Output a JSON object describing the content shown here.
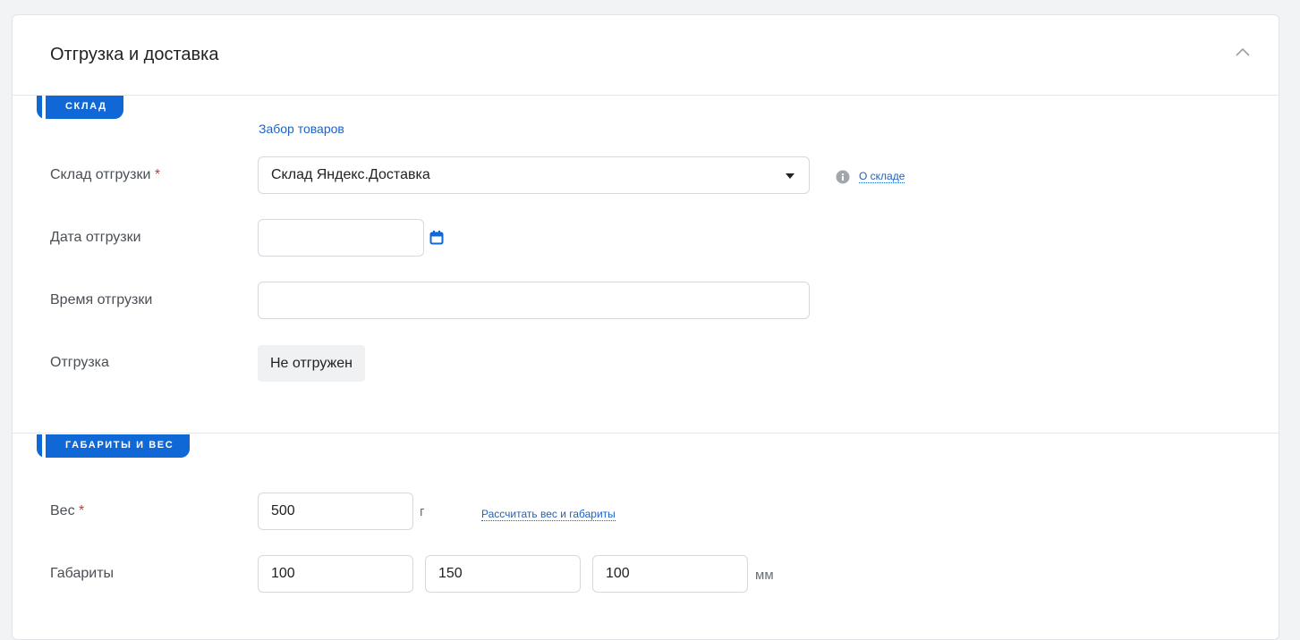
{
  "panel": {
    "title": "Отгрузка и доставка"
  },
  "warehouse_section": {
    "tag": "СКЛАД",
    "pickup_link": "Забор товаров",
    "warehouse": {
      "label": "Склад отгрузки",
      "required_mark": "*",
      "value": "Склад Яндекс.Доставка",
      "info_link": "О складе"
    },
    "ship_date": {
      "label": "Дата отгрузки",
      "value": ""
    },
    "ship_time": {
      "label": "Время отгрузки",
      "value": ""
    },
    "shipment": {
      "label": "Отгрузка",
      "status": "Не отгружен"
    }
  },
  "dimensions_section": {
    "tag": "ГАБАРИТЫ И ВЕС",
    "weight": {
      "label": "Вес",
      "required_mark": "*",
      "value": "500",
      "unit": "г",
      "calc_link": "Рассчитать вес и габариты"
    },
    "dimensions": {
      "label": "Габариты",
      "length": "100",
      "width": "150",
      "height": "100",
      "unit": "мм"
    }
  },
  "colors": {
    "accent": "#1067d6",
    "link": "#1c63c4",
    "required": "#e03131"
  }
}
